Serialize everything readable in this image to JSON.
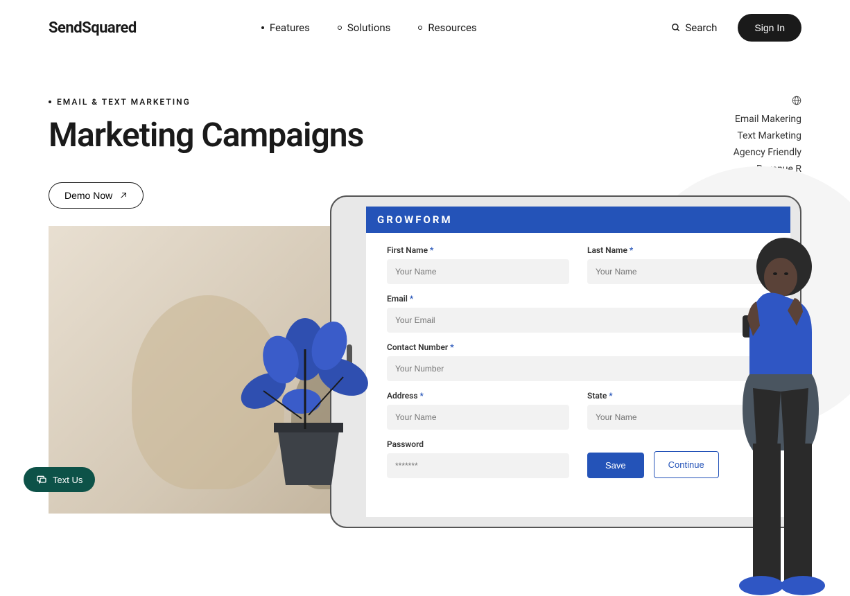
{
  "header": {
    "logo": "SendSquared",
    "nav": {
      "features": "Features",
      "solutions": "Solutions",
      "resources": "Resources"
    },
    "search": "Search",
    "signin": "Sign In"
  },
  "hero": {
    "eyebrow": "EMAIL & TEXT MARKETING",
    "title": "Marketing Campaigns",
    "demo": "Demo Now"
  },
  "sidebar": {
    "items": [
      "Email Makering",
      "Text Marketing",
      "Agency Friendly",
      "Revenue R"
    ]
  },
  "form": {
    "title": "GROWFORM",
    "first_name_label": "First Name",
    "last_name_label": "Last Name",
    "email_label": "Email",
    "contact_label": "Contact Number",
    "address_label": "Address",
    "state_label": "State",
    "password_label": "Password",
    "name_placeholder": "Your Name",
    "email_placeholder": "Your Email",
    "number_placeholder": "Your Number",
    "password_placeholder": "*******",
    "save": "Save",
    "continue": "Continue"
  },
  "textus": "Text Us"
}
